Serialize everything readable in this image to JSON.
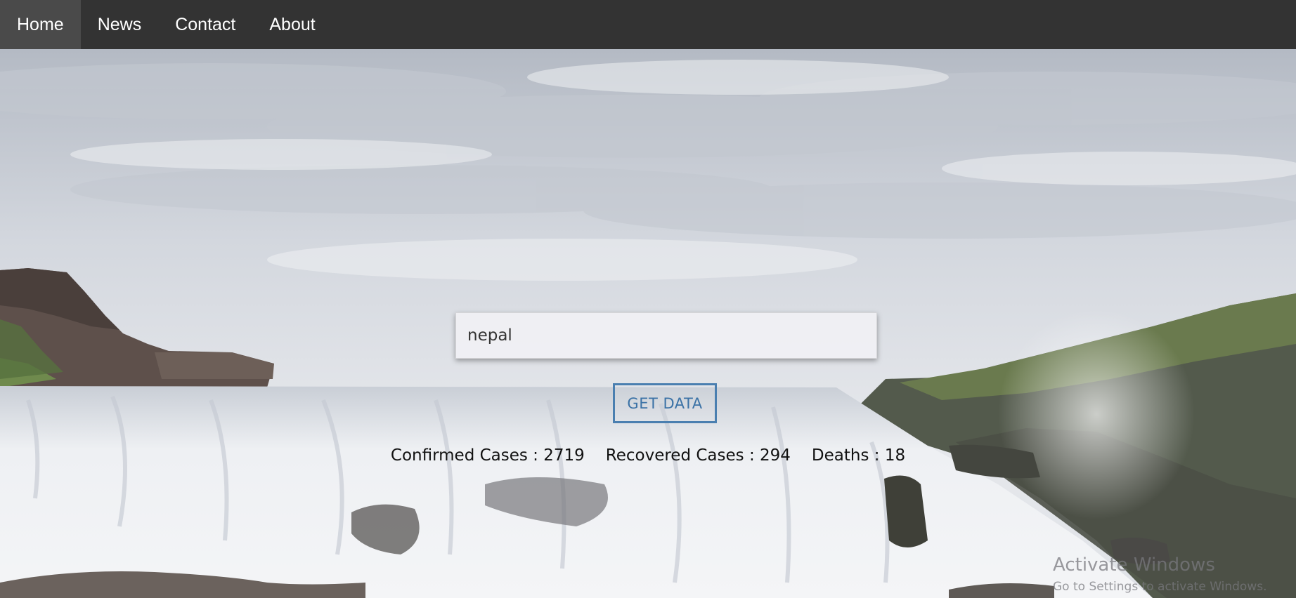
{
  "navbar": {
    "items": [
      {
        "label": "Home",
        "active": true
      },
      {
        "label": "News",
        "active": false
      },
      {
        "label": "Contact",
        "active": false
      },
      {
        "label": "About",
        "active": false
      }
    ]
  },
  "search": {
    "value": "nepal",
    "button_label": "GET DATA"
  },
  "stats": {
    "confirmed": "Confirmed Cases : 2719",
    "recovered": "Recovered Cases : 294",
    "deaths": "Deaths : 18"
  },
  "watermark": {
    "title": "Activate Windows",
    "subtitle": "Go to Settings to activate Windows."
  },
  "colors": {
    "navbar_bg": "#333333",
    "nav_active_bg": "#4a4a4a",
    "button_accent": "#4a7fb0"
  }
}
